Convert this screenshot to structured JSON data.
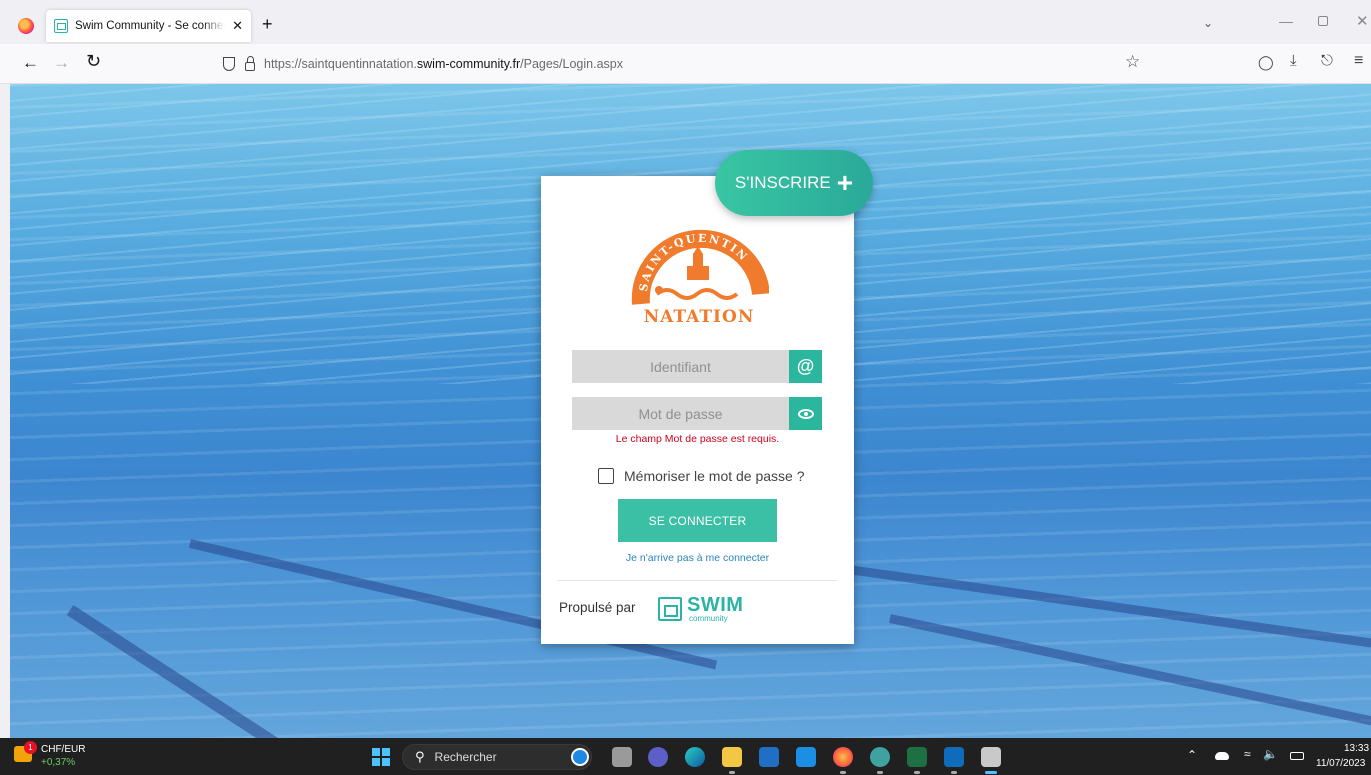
{
  "browser": {
    "tab_title": "Swim Community - Se connecter",
    "tab_close": "✕",
    "new_tab": "+",
    "url_prefix": "https://saintquentinnatation.",
    "url_domain": "swim-community.fr",
    "url_path": "/Pages/Login.aspx"
  },
  "login": {
    "signup_label": "S'INSCRIRE",
    "signup_plus": "+",
    "username_placeholder": "Identifiant",
    "password_placeholder": "Mot de passe",
    "password_error": "Le champ Mot de passe est requis.",
    "remember_label": "Mémoriser le mot de passe ?",
    "submit_label": "SE CONNECTER",
    "forgot_link": "Je n'arrive pas à me connecter",
    "powered_by": "Propulsé par",
    "vendor_name": "SWIM",
    "vendor_sub": "community",
    "club_logo_top": "SAINT-QUENTIN",
    "club_logo_bottom": "NATATION",
    "accent_color": "#2ab79e",
    "error_color": "#d0021b"
  },
  "taskbar": {
    "widget_badge": "1",
    "widget_name": "CHF/EUR",
    "widget_change": "+0,37%",
    "search_placeholder": "Rechercher",
    "time": "13:33",
    "date": "11/07/2023"
  }
}
